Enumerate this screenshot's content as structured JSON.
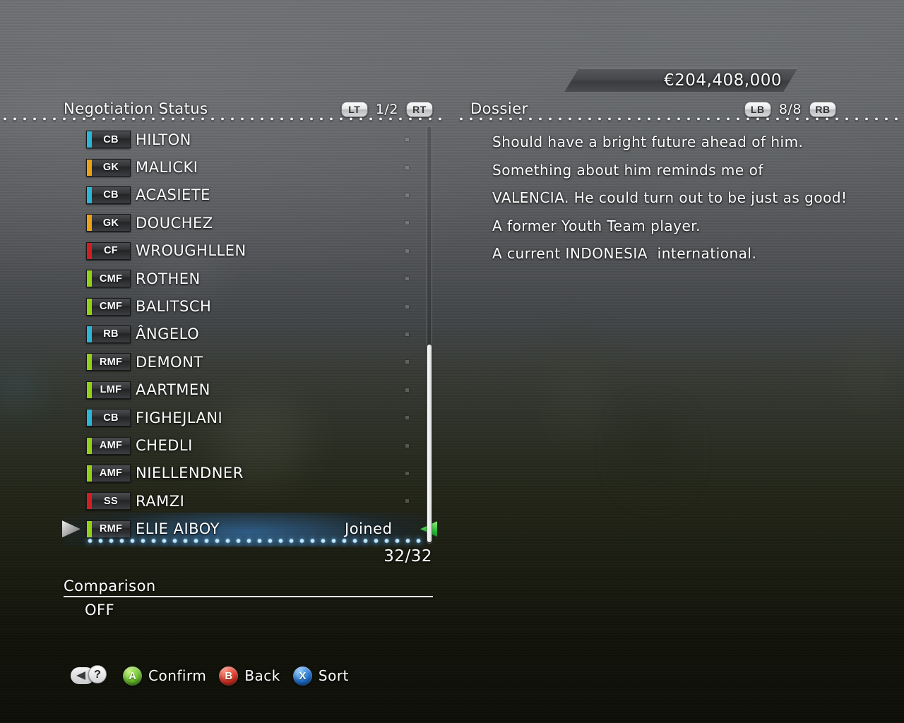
{
  "money": {
    "amount": "€204,408,000"
  },
  "left_panel": {
    "title": "Negotiation Status",
    "pager": {
      "left_badge": "LT",
      "fraction": "1/2",
      "right_badge": "RT"
    },
    "count": "32/32",
    "rows": [
      {
        "pos": "CB",
        "color": "#2bb6d8",
        "name": "HILTON"
      },
      {
        "pos": "GK",
        "color": "#eda117",
        "name": "MALICKI"
      },
      {
        "pos": "CB",
        "color": "#2bb6d8",
        "name": "ACASIETE"
      },
      {
        "pos": "GK",
        "color": "#eda117",
        "name": "DOUCHEZ"
      },
      {
        "pos": "CF",
        "color": "#d01f22",
        "name": "WROUGHLLEN"
      },
      {
        "pos": "CMF",
        "color": "#93d118",
        "name": "ROTHEN"
      },
      {
        "pos": "CMF",
        "color": "#93d118",
        "name": "BALITSCH"
      },
      {
        "pos": "RB",
        "color": "#2bb6d8",
        "name": "ÂNGELO"
      },
      {
        "pos": "RMF",
        "color": "#93d118",
        "name": "DEMONT"
      },
      {
        "pos": "LMF",
        "color": "#93d118",
        "name": "AARTMEN"
      },
      {
        "pos": "CB",
        "color": "#2bb6d8",
        "name": "FIGHEJLANI"
      },
      {
        "pos": "AMF",
        "color": "#93d118",
        "name": "CHEDLI"
      },
      {
        "pos": "AMF",
        "color": "#93d118",
        "name": "NIELLENDNER"
      },
      {
        "pos": "SS",
        "color": "#d01f22",
        "name": "RAMZI"
      },
      {
        "pos": "RMF",
        "color": "#93d118",
        "name": "ELIE AIBOY",
        "selected": true,
        "status": "Joined"
      }
    ]
  },
  "comparison": {
    "label": "Comparison",
    "value": "OFF"
  },
  "right_panel": {
    "title": "Dossier",
    "pager": {
      "left_badge": "LB",
      "fraction": "8/8",
      "right_badge": "RB"
    },
    "lines": [
      "Should have a bright future ahead of him.",
      "Something about him reminds me of",
      "VALENCIA. He could turn out to be just as good!",
      "A former Youth Team player.",
      "A current INDONESIA  international."
    ]
  },
  "legend": {
    "help_icon": "help-question-icon",
    "back_icon": "back-triangle-icon",
    "buttons": [
      {
        "glyph": "A",
        "label": "Confirm",
        "class": "a"
      },
      {
        "glyph": "B",
        "label": "Back",
        "class": "b"
      },
      {
        "glyph": "X",
        "label": "Sort",
        "class": "x"
      }
    ]
  }
}
